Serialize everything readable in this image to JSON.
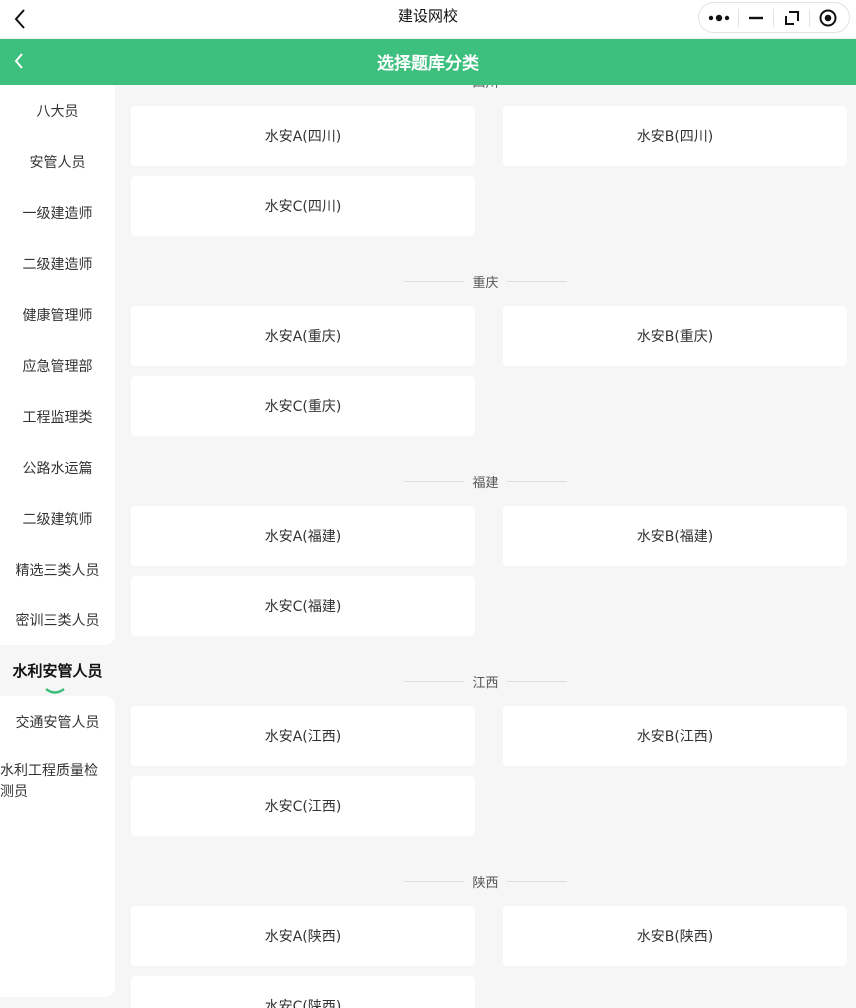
{
  "topbar": {
    "title": "建设网校"
  },
  "header": {
    "title": "选择题库分类"
  },
  "sidebar": {
    "items": [
      {
        "label": "八大员"
      },
      {
        "label": "安管人员"
      },
      {
        "label": "一级建造师"
      },
      {
        "label": "二级建造师"
      },
      {
        "label": "健康管理师"
      },
      {
        "label": "应急管理部"
      },
      {
        "label": "工程监理类"
      },
      {
        "label": "公路水运篇"
      },
      {
        "label": "二级建筑师"
      },
      {
        "label": "精选三类人员"
      },
      {
        "label": "密训三类人员"
      },
      {
        "label": "水利安管人员"
      },
      {
        "label": "交通安管人员"
      },
      {
        "label": "水利工程质量检测员"
      }
    ],
    "active_index": 11,
    "accent": "#3dbf7e"
  },
  "sections": [
    {
      "title": "四川",
      "cards": [
        "水安A(四川)",
        "水安B(四川)",
        "水安C(四川)"
      ]
    },
    {
      "title": "重庆",
      "cards": [
        "水安A(重庆)",
        "水安B(重庆)",
        "水安C(重庆)"
      ]
    },
    {
      "title": "福建",
      "cards": [
        "水安A(福建)",
        "水安B(福建)",
        "水安C(福建)"
      ]
    },
    {
      "title": "江西",
      "cards": [
        "水安A(江西)",
        "水安B(江西)",
        "水安C(江西)"
      ]
    },
    {
      "title": "陕西",
      "cards": [
        "水安A(陕西)",
        "水安B(陕西)",
        "水安C(陕西)"
      ]
    }
  ]
}
